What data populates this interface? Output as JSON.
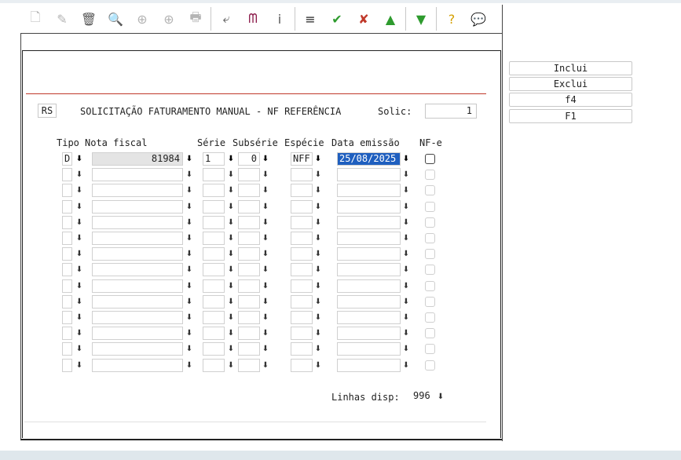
{
  "toolbar": {
    "icons": [
      "new-icon",
      "edit-icon",
      "delete-icon",
      "search-icon",
      "previous-icon",
      "next-icon",
      "print-icon",
      "exit-icon",
      "binoculars-icon",
      "info-icon",
      "list-icon",
      "confirm-icon",
      "cancel-icon",
      "up-icon",
      "down-icon",
      "help-icon",
      "comment-icon"
    ],
    "glyphs": [
      "🗋",
      "✎",
      "🗑",
      "🔍",
      "⊕",
      "⊕",
      "🖶",
      "⤶",
      "ᗰ",
      "i",
      "≡",
      "✔",
      "✘",
      "▲",
      "▼",
      "?",
      "💬"
    ],
    "colors": {
      "confirm": "#2e9b2e",
      "cancel": "#c0392b",
      "arrows": "#2e9b2e",
      "help": "#d4a000",
      "binoculars": "#8b1a4a"
    }
  },
  "form": {
    "code": "RS",
    "title": "SOLICITAÇÃO FATURAMENTO MANUAL - NF REFERÊNCIA",
    "solic_label": "Solic:",
    "solic_value": "1"
  },
  "grid": {
    "headers": {
      "tipo": "Tipo",
      "nota": "Nota fiscal",
      "serie": "Série",
      "subserie": "Subsérie",
      "especie": "Espécie",
      "data": "Data emissão",
      "nfe": "NF-e"
    },
    "first_row": {
      "tipo": "D",
      "nota": "81984",
      "serie": "1",
      "subserie": "0",
      "especie": "NFF",
      "data": "25/08/2025"
    },
    "row_count": 14,
    "dropdown_glyph": "⬇"
  },
  "footer": {
    "linhas_label": "Linhas disp:",
    "linhas_value": "996"
  },
  "side_buttons": [
    "Inclui",
    "Exclui",
    "f4",
    "F1"
  ]
}
